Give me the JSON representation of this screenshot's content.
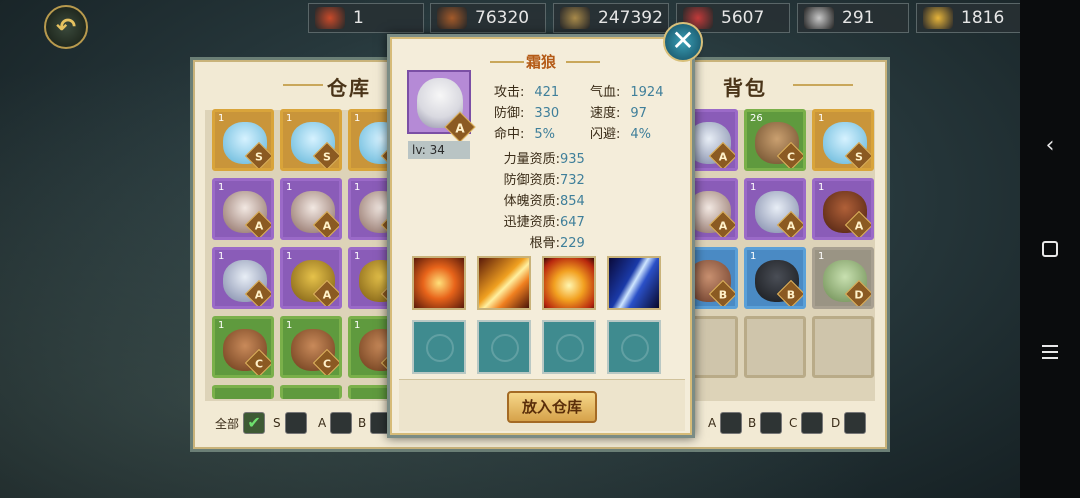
{
  "resources": [
    {
      "icon": "token-icon",
      "value": "1",
      "color": "#c94a2a"
    },
    {
      "icon": "wood-icon",
      "value": "76320",
      "color": "#a35a2a"
    },
    {
      "icon": "gold-bars-icon",
      "value": "247392",
      "color": "#a88a4a"
    },
    {
      "icon": "gem-icon",
      "value": "5607",
      "color": "#c23a3a"
    },
    {
      "icon": "silver-ingot-icon",
      "value": "291",
      "color": "#c8c8c8"
    },
    {
      "icon": "gold-ingot-icon",
      "value": "1816",
      "color": "#e6b43a"
    }
  ],
  "warehouse": {
    "title": "仓库"
  },
  "backpack": {
    "title": "背包"
  },
  "filters": {
    "all": "全部",
    "grades": [
      "S",
      "A",
      "B",
      "C",
      "D"
    ]
  },
  "detail": {
    "name": "霜狼",
    "grade": "A",
    "level": "lv: 34",
    "stats": [
      {
        "label": "攻击:",
        "value": "421"
      },
      {
        "label": "气血:",
        "value": "1924"
      },
      {
        "label": "防御:",
        "value": "330"
      },
      {
        "label": "速度:",
        "value": "97"
      },
      {
        "label": "命中:",
        "value": "5%"
      },
      {
        "label": "闪避:",
        "value": "4%"
      }
    ],
    "aptitudes": [
      {
        "label": "力量资质:",
        "value": "935"
      },
      {
        "label": "防御资质:",
        "value": "732"
      },
      {
        "label": "体魄资质:",
        "value": "854"
      },
      {
        "label": "迅捷资质:",
        "value": "647"
      },
      {
        "label": "根骨:",
        "value": "229"
      }
    ],
    "skills": [
      "fire-ring-icon",
      "fire-slash-icon",
      "flame-burst-icon",
      "ice-claw-icon"
    ],
    "button": "放入仓库"
  },
  "warehouse_cells": [
    {
      "count": "1",
      "grade": "S",
      "art": "ice-beast"
    },
    {
      "count": "1",
      "grade": "S",
      "art": "ice-beast"
    },
    {
      "count": "1",
      "grade": "S",
      "art": "ice-beast"
    },
    {
      "count": "1",
      "grade": "A",
      "art": "boar"
    },
    {
      "count": "1",
      "grade": "A",
      "art": "boar"
    },
    {
      "count": "1",
      "grade": "A",
      "art": "boar"
    },
    {
      "count": "1",
      "grade": "A",
      "art": "wolf"
    },
    {
      "count": "1",
      "grade": "A",
      "art": "tiger"
    },
    {
      "count": "1",
      "grade": "A",
      "art": "tiger"
    },
    {
      "count": "1",
      "grade": "C",
      "art": "lion"
    },
    {
      "count": "1",
      "grade": "C",
      "art": "lion"
    },
    {
      "count": "1",
      "grade": "C",
      "art": "lion"
    }
  ],
  "backpack_cells": [
    {
      "count": "1",
      "grade": "A",
      "art": "wolf"
    },
    {
      "count": "26",
      "grade": "C",
      "art": "lizard"
    },
    {
      "count": "1",
      "grade": "S",
      "art": "ice-beast"
    },
    {
      "count": "1",
      "grade": "A",
      "art": "boar"
    },
    {
      "count": "1",
      "grade": "A",
      "art": "wolf"
    },
    {
      "count": "1",
      "grade": "A",
      "art": "fire-beast"
    },
    {
      "count": "1",
      "grade": "B",
      "art": "deer"
    },
    {
      "count": "1",
      "grade": "B",
      "art": "panther"
    },
    {
      "count": "1",
      "grade": "D",
      "art": "sprout"
    }
  ]
}
